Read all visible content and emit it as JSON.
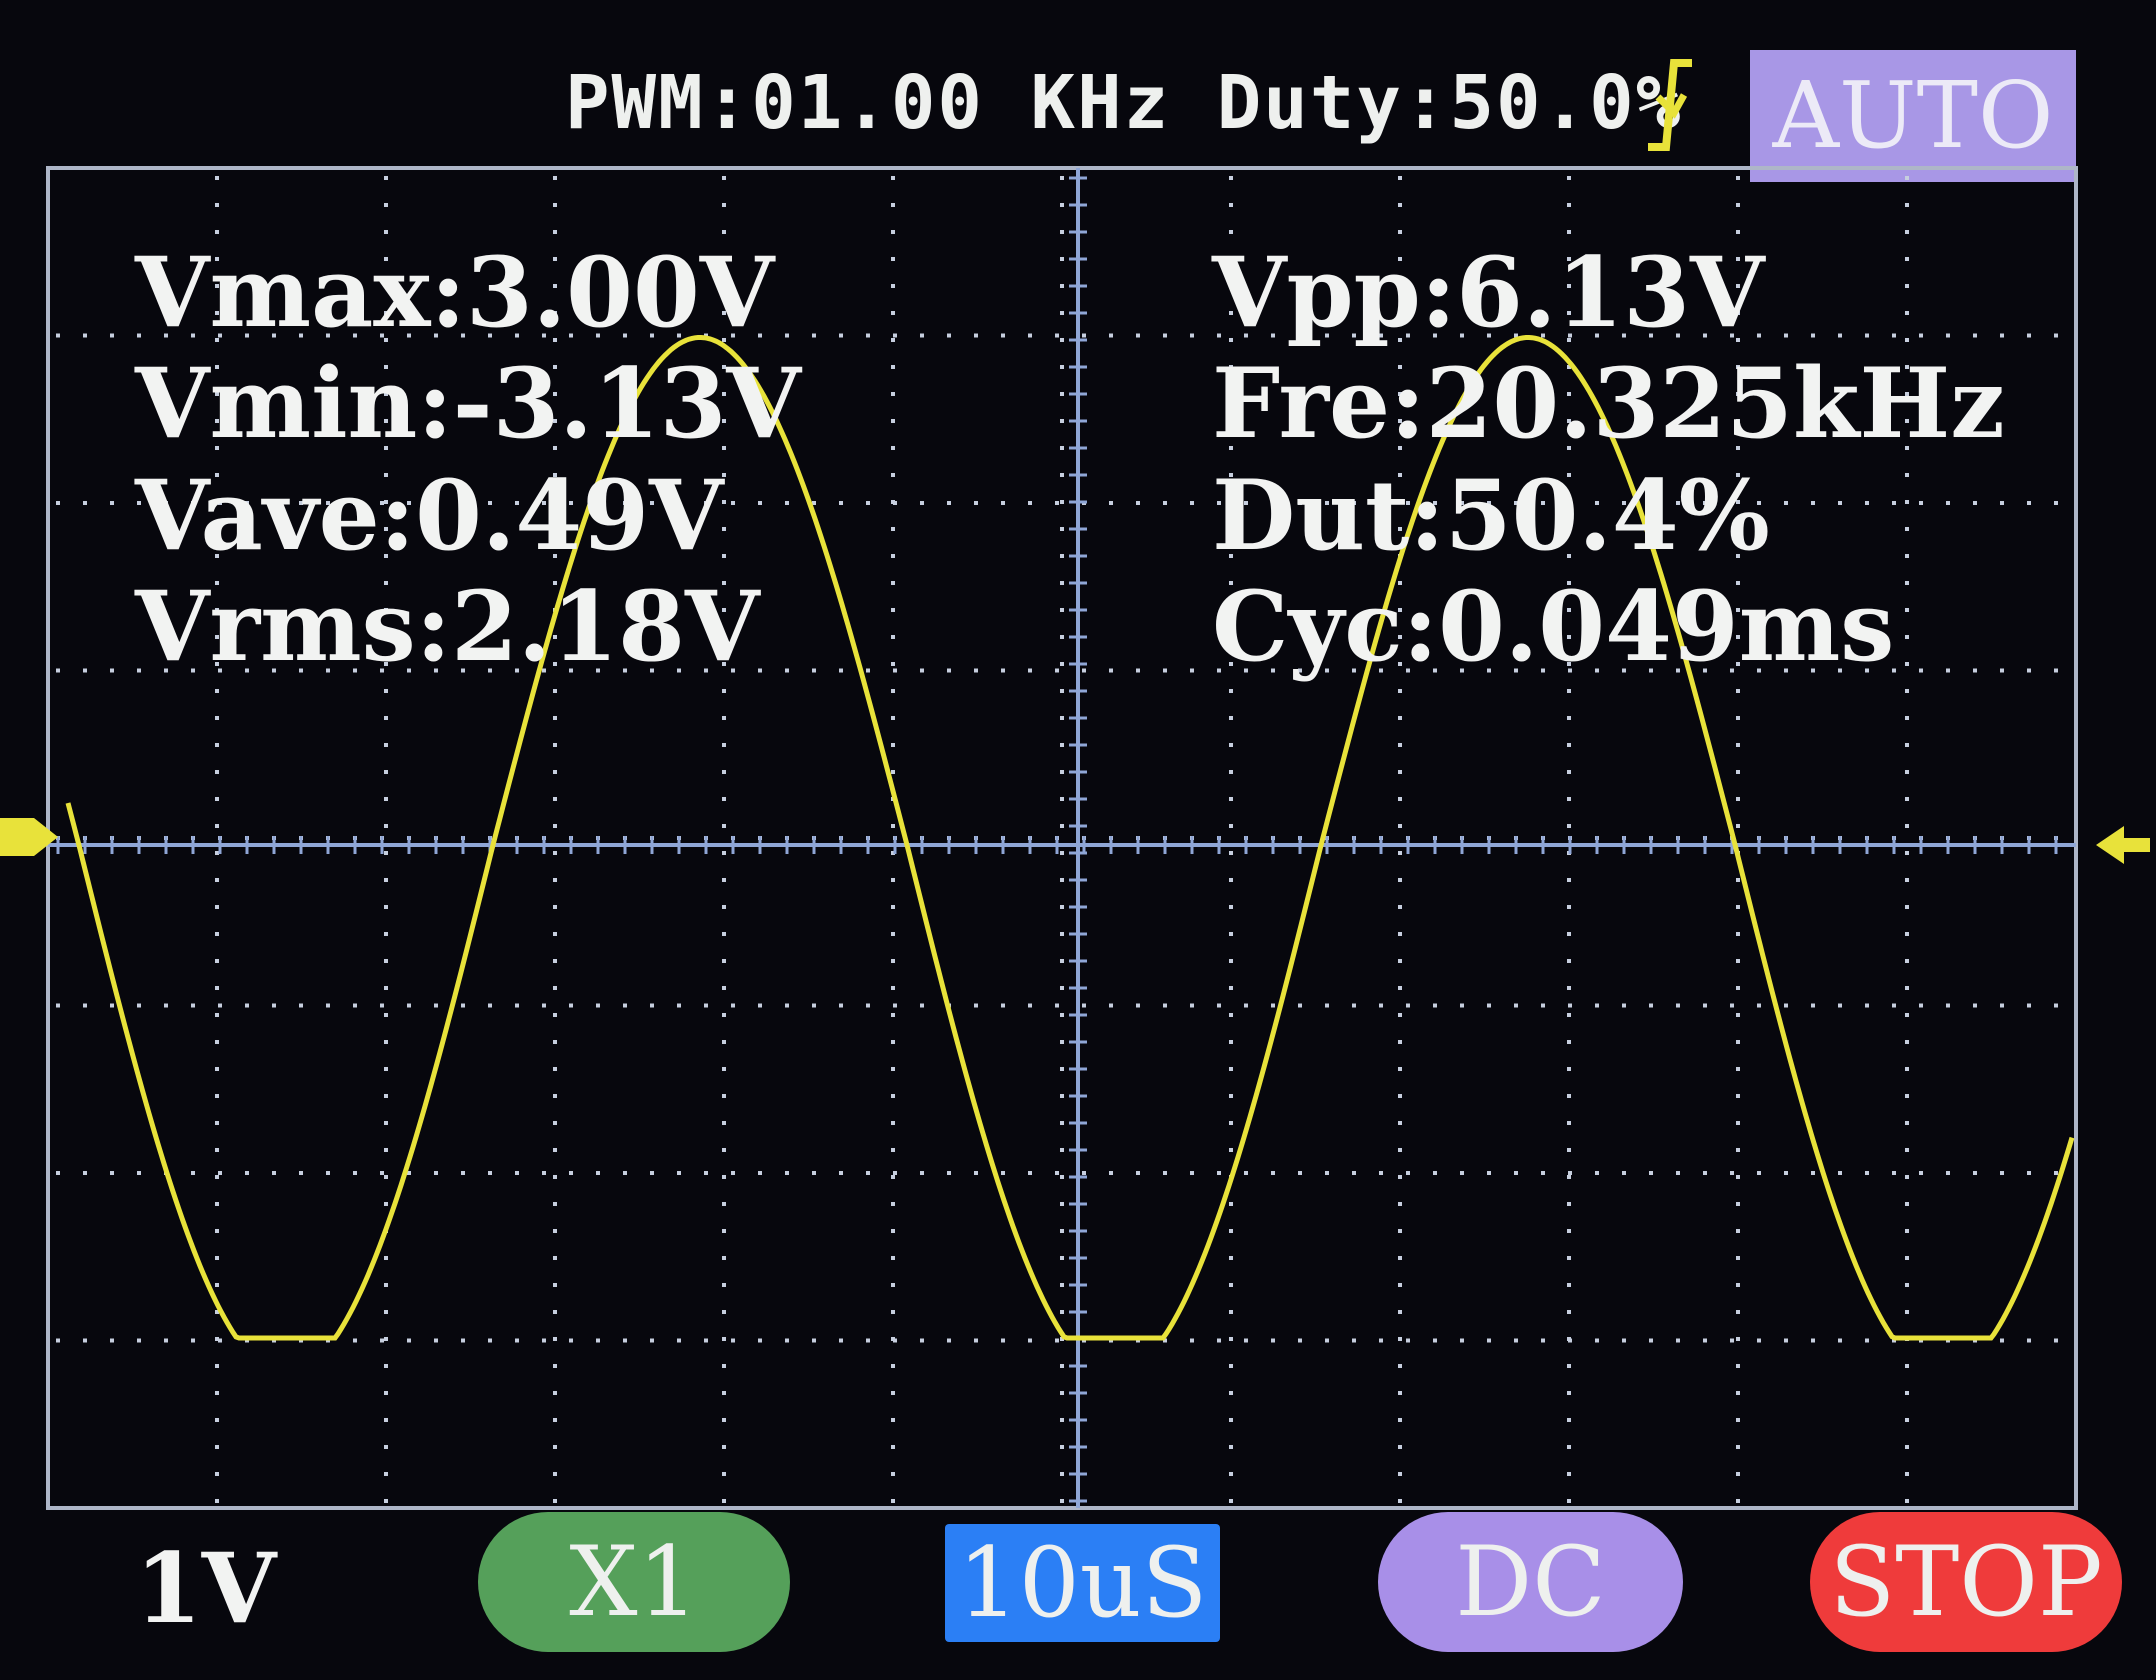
{
  "status_bar": {
    "pwm_text": "PWM:01.00 KHz Duty:50.0%",
    "trigger_mode": "AUTO",
    "trigger_edge_icon": "falling-edge-trigger-icon"
  },
  "measurements": {
    "left": [
      "Vmax:3.00V",
      "Vmin:-3.13V",
      "Vave:0.49V",
      "Vrms:2.18V"
    ],
    "right": [
      "Vpp:6.13V",
      "Fre:20.325kHz",
      "Dut:50.4%",
      "Cyc:0.049ms"
    ]
  },
  "bottom_bar": {
    "volts_per_div": "1V",
    "probe": "X1",
    "timebase": "10uS",
    "coupling": "DC",
    "run_state": "STOP"
  },
  "colors": {
    "trace": "#e8e23a",
    "grid": "#c7cfdf",
    "axis": "#8fa6d6",
    "probe": "#55a05a",
    "timebase": "#2b7ff5",
    "coupling": "#a88fe8",
    "stop": "#ef3b3b",
    "auto": "#a897e6"
  },
  "chart_data": {
    "type": "line",
    "series": [
      {
        "frequency_khz": 20.325,
        "vmax": 3.0,
        "vmin": -3.13,
        "period_ms": 0.049
      }
    ],
    "x_divisions": 12,
    "y_divisions": 8,
    "volts_per_div": 1,
    "time_per_div_us": 10,
    "grid": true
  }
}
